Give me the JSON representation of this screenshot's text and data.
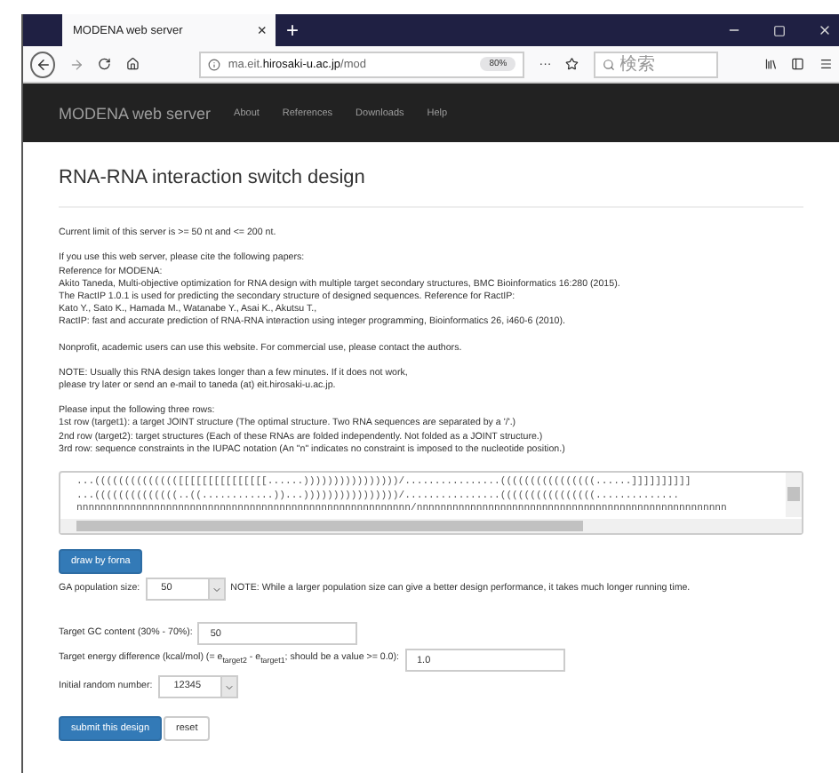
{
  "browser": {
    "tab_title": "MODENA web server",
    "tab_close": "×",
    "new_tab": "+",
    "url": "ma.eit.**hirosaki-u.ac.jp**/mod",
    "zoom": "80%",
    "more": "···",
    "search": {
      "placeholder": "検索"
    }
  },
  "navbar": {
    "brand": "MODENA web server",
    "links": [
      "About",
      "References",
      "Downloads",
      "Help"
    ]
  },
  "page": {
    "title": "RNA-RNA interaction switch design",
    "paragraphs": [
      [
        "Current limit of this server is >= 50 nt and <= 200 nt."
      ],
      [
        "If you use this web server, please cite the following papers:",
        "Reference for MODENA:",
        "Akito Taneda, Multi-objective optimization for RNA design with multiple target secondary structures, BMC Bioinformatics 16:280 (2015).",
        "The RactIP 1.0.1 is used for predicting the secondary structure of designed sequences. Reference for RactIP:",
        "Kato Y., Sato K., Hamada M., Watanabe Y., Asai K., Akutsu T.,",
        "RactIP: fast and accurate prediction of RNA-RNA interaction using integer programming, Bioinformatics 26, i460-6 (2010)."
      ],
      [
        "Nonprofit, academic users can use this website. For commercial use, please contact the authors."
      ],
      [
        "NOTE: Usually this RNA design takes longer than a few minutes. If it does not work,",
        "please try later or send an e-mail to taneda (at) eit.hirosaki-u.ac.jp."
      ],
      [
        "Please input the following three rows:",
        "1st row (target1): a target JOINT structure (The optimal structure. Two RNA sequences are separated by a '/'.)",
        "2nd row (target2): target structures (Each of these RNAs are folded independently. Not folded as a JOINT structure.)",
        "3rd row: sequence constraints in the IUPAC notation (An \"n\" indicates no constraint is imposed to the nucleotide position.)"
      ]
    ],
    "sequence_lines": [
      "...(((((((((((((([[[[[[[[[[[[[[[......))))))))))))))))/................((((((((((((((((......]]]]]]]]]]",
      "...((((((((((((((..((............))...))))))))))))))))/................((((((((((((((((..............",
      "nnnnnnnnnnnnnnnnnnnnnnnnnnnnnnnnnnnnnnnnnnnnnnnnnnnnnnnn/nnnnnnnnnnnnnnnnnnnnnnnnnnnnnnnnnnnnnnnnnnnnnnnnnnnn"
    ],
    "draw_button": "draw by forna",
    "ga_population": {
      "label": "GA population size:",
      "value": "50",
      "note": "NOTE: While a larger population size can give a better design performance, it takes much longer running time."
    },
    "gc_content": {
      "label": "Target GC content (30% - 70%):",
      "value": "50"
    },
    "energy_difference": {
      "label": "Target energy difference (kcal/mol) (= e$_{target2}$ - e$_{target1}$; should be a value >= 0.0):",
      "value": "1.0"
    },
    "random_number": {
      "label": "Initial random number:",
      "value": "12345"
    },
    "buttons": [
      {
        "label": "submit this design",
        "kind": "primary"
      },
      {
        "label": "reset",
        "kind": "default"
      }
    ]
  }
}
